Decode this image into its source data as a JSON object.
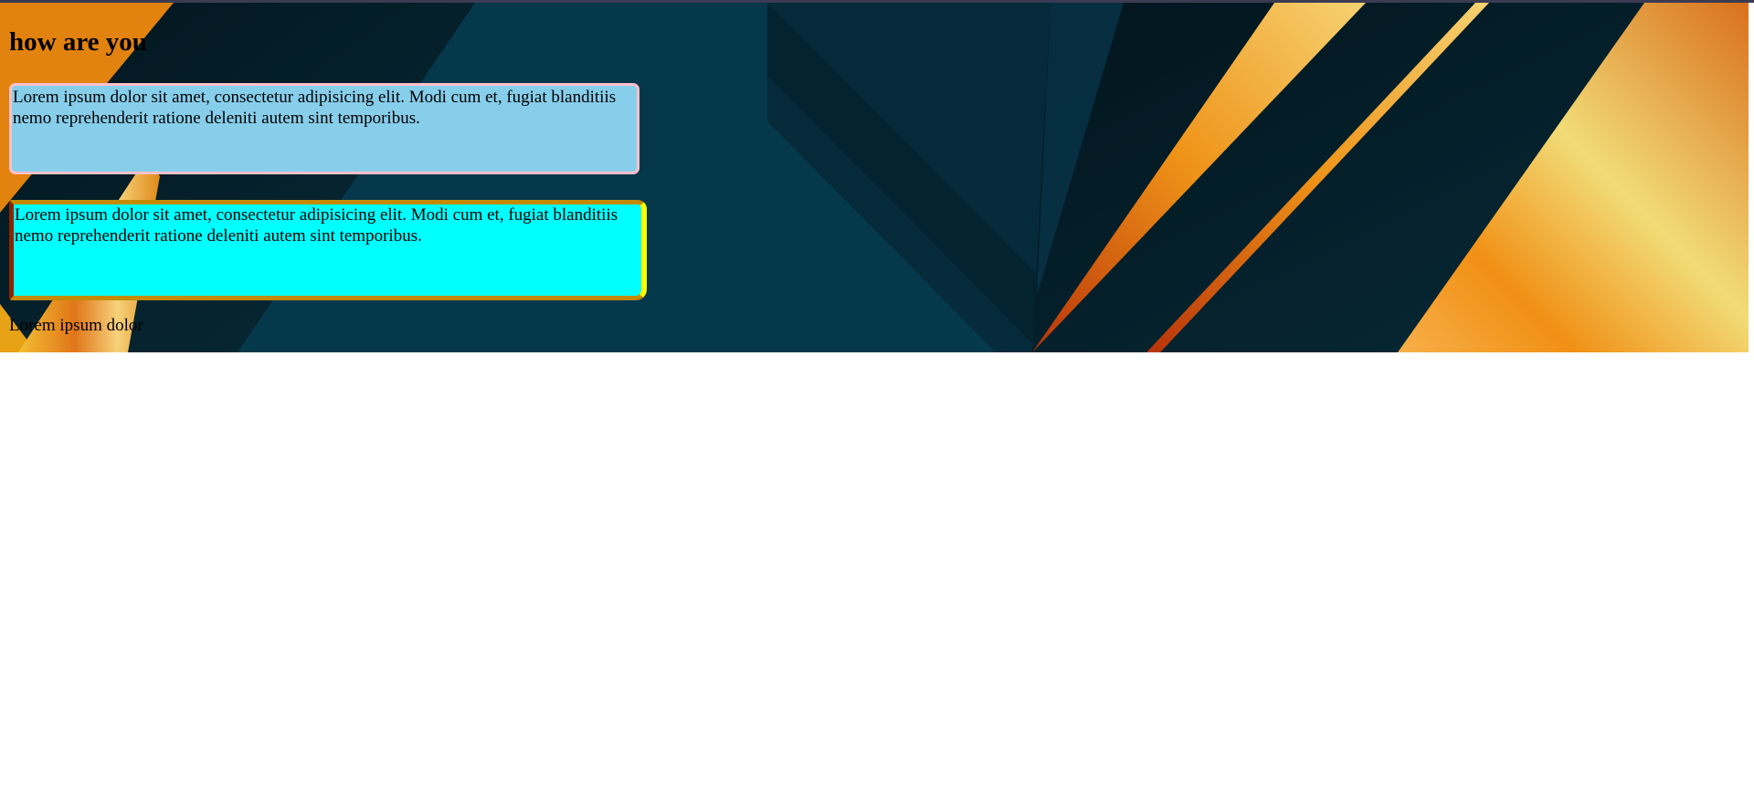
{
  "page": {
    "heading": "how are you",
    "box1_text": "Lorem ipsum dolor sit amet, consectetur adipisicing elit. Modi cum et, fugiat blanditiis nemo reprehenderit ratione deleniti autem sint temporibus.",
    "box2_text": "Lorem ipsum dolor sit amet, consectetur adipisicing elit. Modi cum et, fugiat blanditiis nemo reprehenderit ratione deleniti autem sint temporibus.",
    "footer_text": "Lorem ipsum dolor"
  },
  "colors": {
    "box1_background": "#87ceeb",
    "box1_border": "#ffc0cb",
    "box2_background": "#00ffff",
    "box2_border_right": "#ffff00",
    "box2_border_top_bottom": "#c48a00",
    "box2_border_left": "#8b2500",
    "hero_base": "#06384c",
    "hero_accent_orange": "#f08c10",
    "hero_accent_gold": "#f2dc78"
  }
}
